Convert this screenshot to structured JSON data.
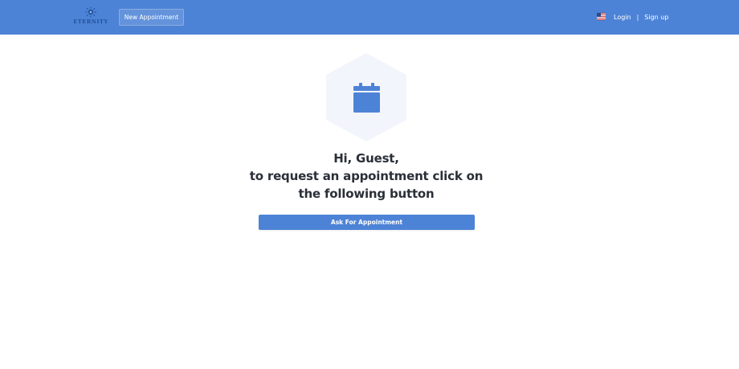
{
  "header": {
    "logo_text": "ETERNITY",
    "new_appointment_label": "New Appointment",
    "login_label": "Login",
    "separator": "|",
    "signup_label": "Sign up",
    "language_icon": "us-flag-icon"
  },
  "main": {
    "icon": "calendar-icon",
    "greeting": "Hi, Guest,",
    "line2": "to request an appointment click on",
    "line3": "the following button",
    "ask_button_label": "Ask For Appointment"
  },
  "colors": {
    "primary": "#4d83d6",
    "hex_bg": "#f2f5fb",
    "text": "#2b2f38"
  }
}
